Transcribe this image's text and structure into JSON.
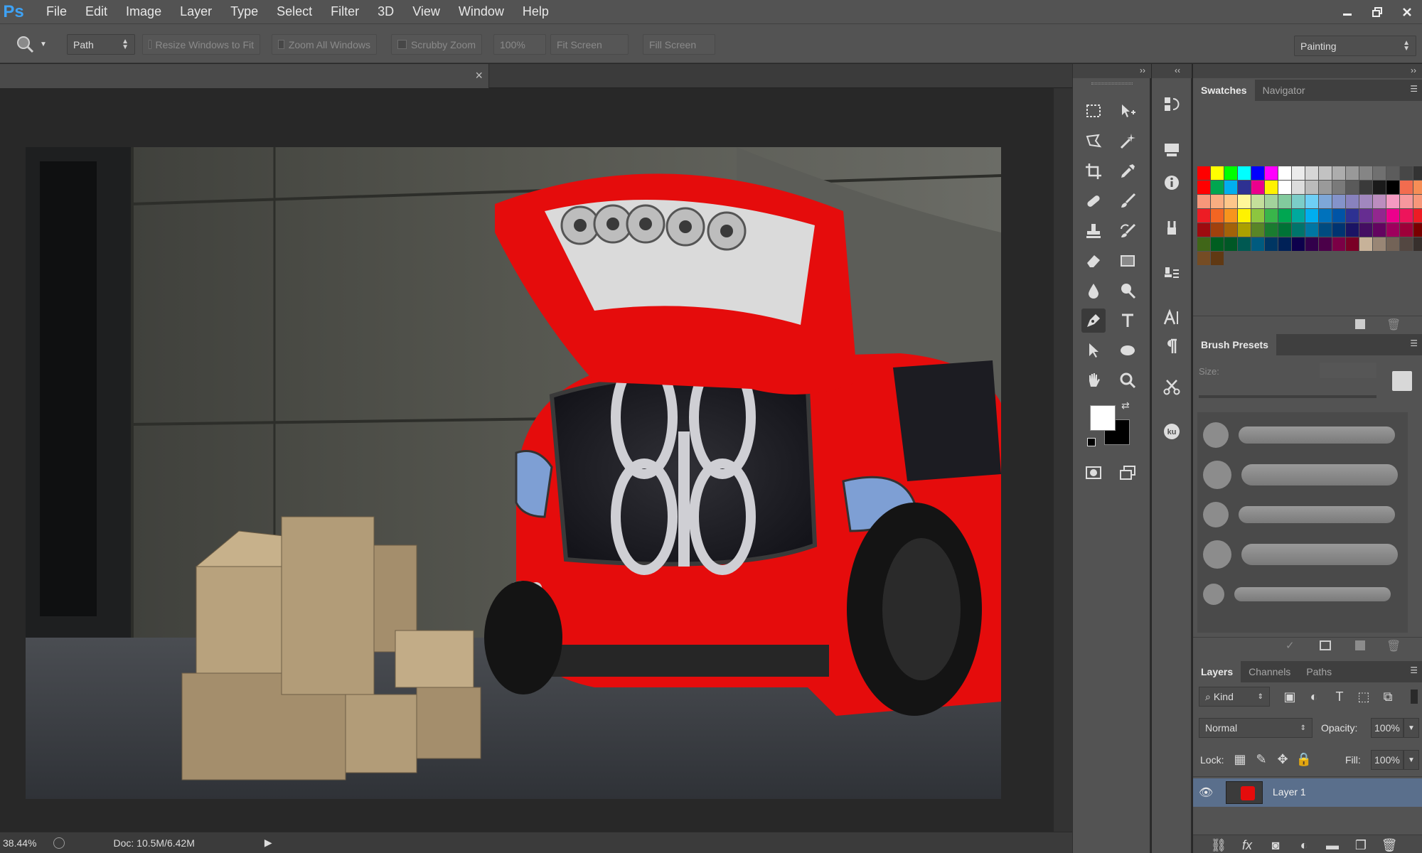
{
  "app": {
    "logo": "Ps"
  },
  "menu": [
    "File",
    "Edit",
    "Image",
    "Layer",
    "Type",
    "Select",
    "Filter",
    "3D",
    "View",
    "Window",
    "Help"
  ],
  "options_bar": {
    "mode_select": "Path",
    "resize_windows": "Resize Windows to Fit",
    "zoom_all": "Zoom All Windows",
    "scrubby_zoom": "Scrubby Zoom",
    "zoom_100": "100%",
    "fit_screen": "Fit Screen",
    "fill_screen": "Fill Screen",
    "workspace": "Painting"
  },
  "status_bar": {
    "zoom": "38.44%",
    "doc": "Doc: 10.5M/6.42M"
  },
  "panels": {
    "swatches_tab": "Swatches",
    "navigator_tab": "Navigator",
    "brush_presets_tab": "Brush Presets",
    "size_label": "Size:",
    "layers_tab": "Layers",
    "channels_tab": "Channels",
    "paths_tab": "Paths",
    "kind_filter": "Kind",
    "blend_mode": "Normal",
    "opacity_label": "Opacity:",
    "opacity_value": "100%",
    "lock_label": "Lock:",
    "fill_label": "Fill:",
    "fill_value": "100%",
    "layer_name": "Layer 1"
  },
  "colors": {
    "foreground": "#ffffff",
    "background": "#000000",
    "car_red": "#e50c0c",
    "layer_selected": "#5a6f8c",
    "swatches": [
      "#ff0000",
      "#ffff00",
      "#00ff00",
      "#00ffff",
      "#0000ff",
      "#ff00ff",
      "#ffffff",
      "#ebebeb",
      "#d6d6d6",
      "#c2c2c2",
      "#adadad",
      "#999999",
      "#858585",
      "#707070",
      "#5c5c5c",
      "#474747",
      "#333333",
      "#1f1f1f",
      "#0a0a0a",
      "#000000",
      "#ff0000",
      "#00a650",
      "#00aeef",
      "#2e3192",
      "#ec008c",
      "#fff200",
      "#ffffff",
      "#dcdcdc",
      "#bbbbbb",
      "#9a9a9a",
      "#7a7a7a",
      "#5a5a5a",
      "#3a3a3a",
      "#1a1a1a",
      "#000000",
      "#f26c4f",
      "#f68e56",
      "#fbaf5d",
      "#fff568",
      "#ff0000",
      "#f7977a",
      "#f9ad81",
      "#fdc68a",
      "#fff79a",
      "#c4df9b",
      "#a3d39c",
      "#82ca9d",
      "#7bcdc8",
      "#6ecff6",
      "#7ea7d8",
      "#8493ca",
      "#8882be",
      "#a187be",
      "#bc8dbf",
      "#f49ac2",
      "#f6989d",
      "#f7977a",
      "#f9ad81",
      "#fdc68a",
      "#fff79a",
      "#ed1c24",
      "#f26522",
      "#f7941d",
      "#fff200",
      "#8dc63f",
      "#39b54a",
      "#00a651",
      "#00a99d",
      "#00aeef",
      "#0072bc",
      "#0054a6",
      "#2e3192",
      "#662d91",
      "#92278f",
      "#ec008c",
      "#ed145b",
      "#ed1c24",
      "#f26522",
      "#f7941d",
      "#fff200",
      "#9e0b0f",
      "#a0410d",
      "#a36209",
      "#aba000",
      "#598527",
      "#1a7b30",
      "#007236",
      "#00746b",
      "#0076a3",
      "#004b80",
      "#003471",
      "#1b1464",
      "#440e62",
      "#630460",
      "#9e005d",
      "#9e0039",
      "#790000",
      "#7b2e00",
      "#7d4900",
      "#827b00",
      "#406618",
      "#005e20",
      "#005826",
      "#005952",
      "#005b7f",
      "#003663",
      "#002157",
      "#0d004c",
      "#32004b",
      "#4b0049",
      "#7b0046",
      "#7a0026",
      "#c7b299",
      "#998675",
      "#736357",
      "#534741",
      "#37302d",
      "#c69c6d",
      "#a67c52",
      "#8c6239",
      "#754c24",
      "#603913"
    ]
  }
}
